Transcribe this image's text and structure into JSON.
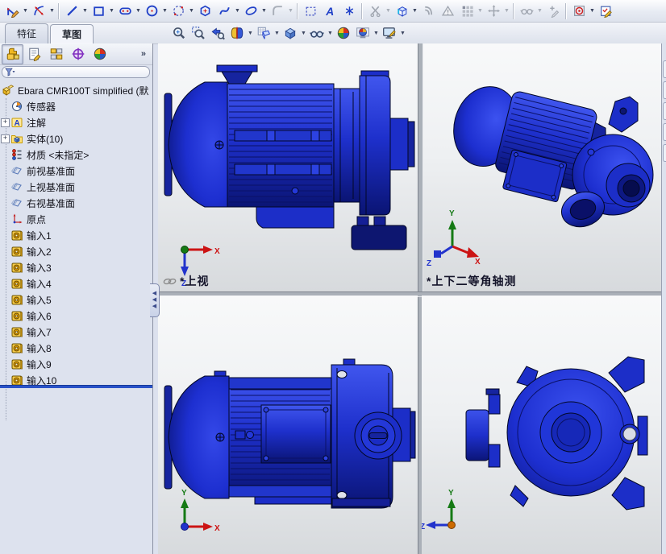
{
  "command_tabs": {
    "features": "特征",
    "sketch": "草图"
  },
  "sketch_toolbar_items": [
    "sketch",
    "smart-dimension",
    "line",
    "rectangle",
    "slot",
    "circle",
    "perimeter-circle",
    "polygon",
    "spline",
    "ellipse",
    "fillet",
    "selection-box",
    "text",
    "point",
    "trim-entities",
    "convert-entities",
    "offset-entities",
    "check-sketch",
    "linear-pattern",
    "move-entities",
    "display-relations",
    "repair-sketch",
    "quick-snaps",
    "rapid-sketch"
  ],
  "view_toolbar_items": [
    "zoom-fit",
    "zoom-area",
    "previous-view",
    "section-view",
    "view-orientation",
    "display-style",
    "hide-show-items",
    "edit-appearance",
    "apply-scene",
    "view-settings"
  ],
  "window_buttons": [
    "pane-left",
    "pane-right",
    "minimize",
    "restore",
    "close"
  ],
  "sidebar": {
    "panel_tabs": [
      "featuremanager",
      "propertymanager",
      "configurationmanager",
      "dimxpertmanager",
      "displaymanager"
    ],
    "overflow_chevron": "»",
    "tree": {
      "root_label": "Ebara CMR100T simplified  (默",
      "items": [
        {
          "label": "传感器",
          "icon": "sensors"
        },
        {
          "label": "注解",
          "icon": "annotations",
          "expandable": true
        },
        {
          "label": "实体(10)",
          "icon": "solid-bodies",
          "expandable": true
        },
        {
          "label": "材质 <未指定>",
          "icon": "material"
        },
        {
          "label": "前视基准面",
          "icon": "plane"
        },
        {
          "label": "上视基准面",
          "icon": "plane"
        },
        {
          "label": "右视基准面",
          "icon": "plane"
        },
        {
          "label": "原点",
          "icon": "origin"
        },
        {
          "label": "输入1",
          "icon": "imported"
        },
        {
          "label": "输入2",
          "icon": "imported"
        },
        {
          "label": "输入3",
          "icon": "imported"
        },
        {
          "label": "输入4",
          "icon": "imported"
        },
        {
          "label": "输入5",
          "icon": "imported"
        },
        {
          "label": "输入6",
          "icon": "imported"
        },
        {
          "label": "输入7",
          "icon": "imported"
        },
        {
          "label": "输入8",
          "icon": "imported"
        },
        {
          "label": "输入9",
          "icon": "imported"
        },
        {
          "label": "输入10",
          "icon": "imported"
        }
      ]
    }
  },
  "viewports": {
    "top_left": {
      "label": "*上视",
      "axis_x": "X",
      "axis_z": "Z"
    },
    "top_right": {
      "label": "*上下二等角轴测",
      "axis_x": "X",
      "axis_y": "Y",
      "axis_z": "Z"
    },
    "bottom_left": {
      "axis_x": "X",
      "axis_y": "Y"
    },
    "bottom_right": {
      "axis_y": "Y",
      "axis_z": "Z"
    }
  },
  "model": {
    "part_name": "Ebara CMR100T simplified",
    "body_color": "#1e32d2"
  },
  "colors": {
    "pump_blue": "#1e32d2",
    "pump_dark": "#0c1678",
    "pump_light": "#3a52ee",
    "axis_x_red": "#cc1414",
    "axis_y_green": "#157a15",
    "axis_z_blue": "#2233cc",
    "tree_separator_blue": "#2a52c8"
  }
}
